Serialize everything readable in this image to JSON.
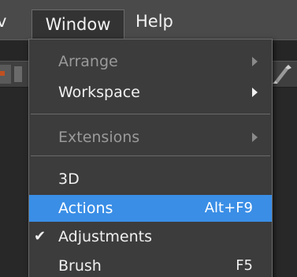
{
  "menubar": {
    "items": [
      {
        "label": "v"
      },
      {
        "label": "Window"
      },
      {
        "label": "Help"
      }
    ]
  },
  "window_menu": {
    "items": [
      {
        "label": "Arrange",
        "enabled": false,
        "submenu": true
      },
      {
        "label": "Workspace",
        "enabled": true,
        "submenu": true
      },
      {
        "label": "Extensions",
        "enabled": false,
        "submenu": true
      },
      {
        "label": "3D",
        "enabled": true
      },
      {
        "label": "Actions",
        "shortcut": "Alt+F9",
        "highlighted": true
      },
      {
        "label": "Adjustments",
        "checked": true,
        "check_mark": "✔"
      },
      {
        "label": "Brush",
        "shortcut": "F5"
      }
    ]
  },
  "colors": {
    "highlight": "#3a8ee6",
    "menu_bg": "#3c3c3c",
    "menubar_bg": "#4a4a4a",
    "disabled_text": "#9a9a9a"
  }
}
